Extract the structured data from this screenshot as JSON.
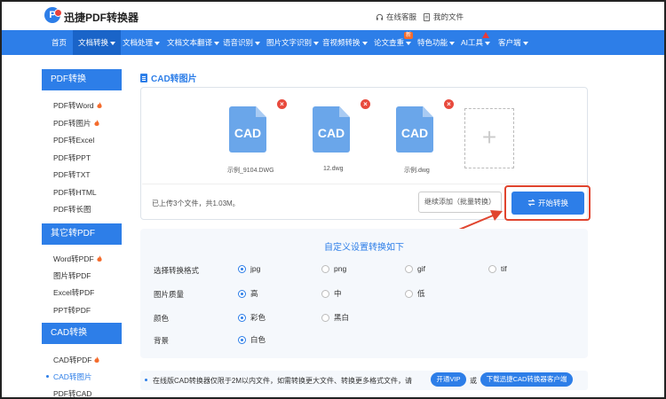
{
  "header": {
    "brand": "迅捷PDF转换器",
    "online_service": "在线客服",
    "my_files": "我的文件"
  },
  "nav": {
    "items": [
      {
        "label": "首页",
        "caret": false
      },
      {
        "label": "文档转换",
        "caret": true
      },
      {
        "label": "文档处理",
        "caret": true
      },
      {
        "label": "文档文本翻译",
        "caret": true
      },
      {
        "label": "语音识别",
        "caret": true
      },
      {
        "label": "图片文字识别",
        "caret": true
      },
      {
        "label": "音视频转换",
        "caret": true
      },
      {
        "label": "论文查重",
        "caret": true
      },
      {
        "label": "特色功能",
        "caret": true
      },
      {
        "label": "AI工具",
        "caret": true
      },
      {
        "label": "客户端",
        "caret": true
      }
    ],
    "new_badge": "新"
  },
  "sidebar": {
    "pdf_section": "PDF转换",
    "pdf_items": [
      {
        "label": "PDF转Word",
        "hot": true
      },
      {
        "label": "PDF转图片",
        "hot": true
      },
      {
        "label": "PDF转Excel",
        "hot": false
      },
      {
        "label": "PDF转PPT",
        "hot": false
      },
      {
        "label": "PDF转TXT",
        "hot": false
      },
      {
        "label": "PDF转HTML",
        "hot": false
      },
      {
        "label": "PDF转长图",
        "hot": false
      }
    ],
    "other_section": "其它转PDF",
    "other_items": [
      {
        "label": "Word转PDF",
        "hot": true
      },
      {
        "label": "图片转PDF",
        "hot": false
      },
      {
        "label": "Excel转PDF",
        "hot": false
      },
      {
        "label": "PPT转PDF",
        "hot": false
      }
    ],
    "cad_section": "CAD转换",
    "cad_items": [
      {
        "label": "CAD转PDF",
        "hot": true
      },
      {
        "label": "CAD转图片",
        "hot": false,
        "active": true
      },
      {
        "label": "PDF转CAD",
        "hot": false
      }
    ]
  },
  "main": {
    "title": "CAD转图片",
    "files": [
      {
        "icon_text": "CAD",
        "name": "示例_9104.DWG"
      },
      {
        "icon_text": "CAD",
        "name": "12.dwg"
      },
      {
        "icon_text": "CAD",
        "name": "示例.dwg"
      }
    ],
    "add_plus": "+",
    "remove_glyph": "×",
    "upload_status": "已上传3个文件，共1.03M。",
    "add_more_button": "继续添加（批量转换）",
    "start_button": "开始转换",
    "settings": {
      "title": "自定义设置转换如下",
      "rows": [
        {
          "label": "选择转换格式",
          "options": [
            "jpg",
            "png",
            "gif",
            "tif"
          ],
          "selected": 0
        },
        {
          "label": "图片质量",
          "options": [
            "高",
            "中",
            "低"
          ],
          "selected": 0
        },
        {
          "label": "颜色",
          "options": [
            "彩色",
            "黑白"
          ],
          "selected": 0
        },
        {
          "label": "背景",
          "options": [
            "白色"
          ],
          "selected": 0
        }
      ]
    },
    "notice": {
      "text": "在线版CAD转换器仅限于2M以内文件，如需转换更大文件、转换更多格式文件，请",
      "vip_button": "开通VIP",
      "or": "或",
      "download_button": "下载迅捷CAD转换器客户端"
    }
  },
  "colors": {
    "primary": "#2d7ee8",
    "nav_active": "#1a64c8",
    "danger": "#e84a3d",
    "annotation": "#e0442e"
  }
}
